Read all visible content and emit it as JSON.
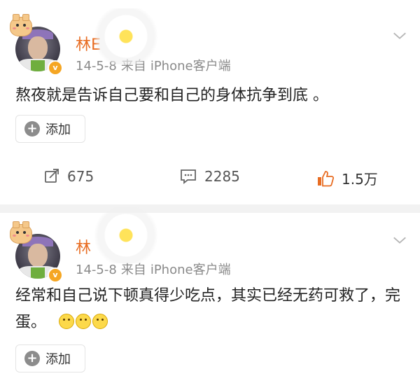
{
  "posts": [
    {
      "username": "林",
      "username_partial": "E",
      "time": "14-5-8",
      "source_prefix": "来自",
      "source": "iPhone客户端",
      "content": "熬夜就是告诉自己要和自己的身体抗争到底 。",
      "add_label": "添加",
      "repost_count": "675",
      "comment_count": "2285",
      "like_count": "1.5万"
    },
    {
      "username": "林",
      "time": "14-5-8",
      "source_prefix": "来自",
      "source": "iPhone客户端",
      "content": "经常和自己说下顿真得少吃点，其实已经无药可救了，完蛋。",
      "add_label": "添加"
    }
  ],
  "colors": {
    "username": "#e86d23",
    "meta": "#8a8a8a",
    "like_accent": "#e86d23",
    "separator": "#f2f2f2"
  },
  "icons": {
    "chevron": "chevron-down-icon",
    "add": "plus-circle-icon",
    "repost": "repost-icon",
    "comment": "comment-icon",
    "like": "thumbs-up-icon",
    "verify": "verified-badge-icon"
  }
}
